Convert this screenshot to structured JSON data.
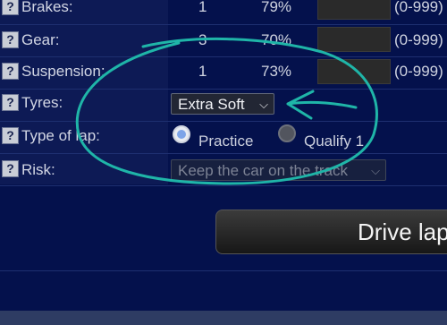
{
  "rows": [
    {
      "label": "Brakes:",
      "num": "1",
      "pct": "79%",
      "range": "(0-999)"
    },
    {
      "label": "Gear:",
      "num": "3",
      "pct": "70%",
      "range": "(0-999)"
    },
    {
      "label": "Suspension:",
      "num": "1",
      "pct": "73%",
      "range": "(0-999)"
    }
  ],
  "tyres": {
    "label": "Tyres:",
    "value": "Extra Soft"
  },
  "lap": {
    "label": "Type of lap:",
    "option1": "Practice",
    "option2": "Qualify 1",
    "selected": "Practice"
  },
  "risk": {
    "label": "Risk:",
    "value": "Keep the car on the track"
  },
  "help_glyph": "?",
  "chevron": "⌵",
  "drive_button": "Drive lap",
  "colors": {
    "background": "#04114c",
    "panel": "#0d1a55",
    "annotation": "#1fb5a8"
  }
}
